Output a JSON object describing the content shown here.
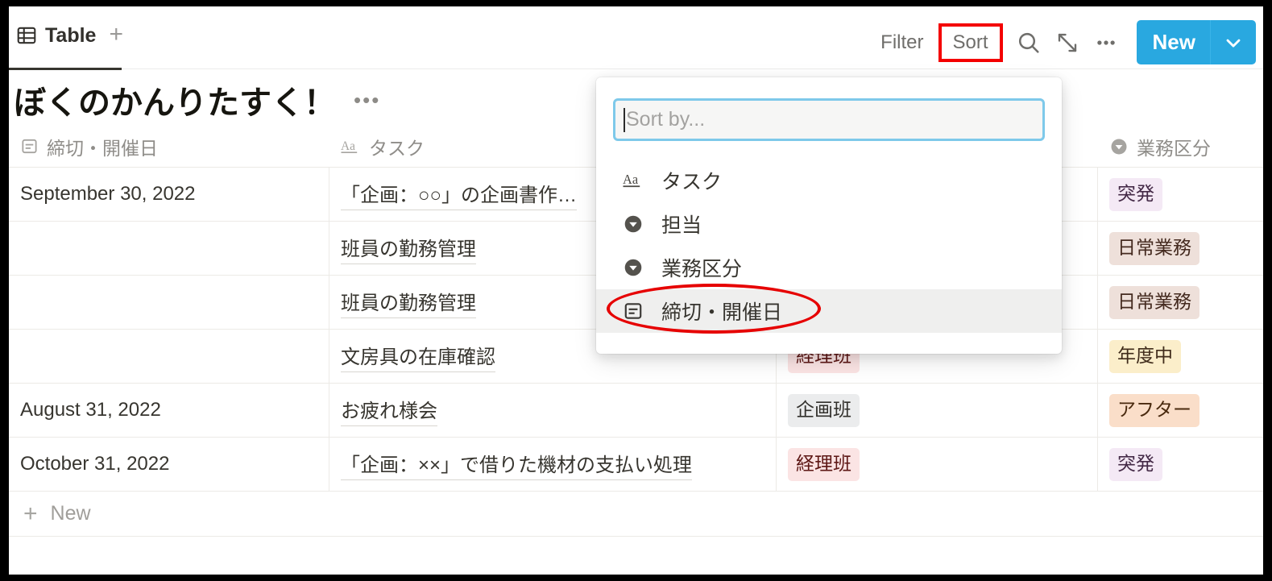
{
  "toolbar": {
    "view_tab_label": "Table",
    "add_view_label": "+",
    "filter_label": "Filter",
    "sort_label": "Sort",
    "search_icon": "search-icon",
    "expand_icon": "expand-icon",
    "more_icon": "more-horizontal-icon",
    "new_label": "New",
    "new_caret_icon": "chevron-down-icon",
    "accent_color": "#29a8e0",
    "highlight_color": "#f40000"
  },
  "page": {
    "title": "ぼくのかんりたすく！",
    "title_menu_icon": "more-horizontal-icon"
  },
  "table": {
    "columns": [
      {
        "label": "締切・開催日",
        "icon": "calendar-date-icon"
      },
      {
        "label": "タスク",
        "icon": "text-aa-icon"
      },
      {
        "label": "",
        "icon": ""
      },
      {
        "label": "業務区分",
        "icon": "select-chevron-icon"
      }
    ],
    "rows": [
      {
        "date": "September 30, 2022",
        "task": "「企画：○○」の企画書作…",
        "team": "",
        "team_style": "",
        "category": "突発",
        "category_style": "tag-purple"
      },
      {
        "date": "",
        "task": "班員の勤務管理",
        "team": "",
        "team_style": "",
        "category": "日常業務",
        "category_style": "tag-brown"
      },
      {
        "date": "",
        "task": "班員の勤務管理",
        "team": "",
        "team_style": "",
        "category": "日常業務",
        "category_style": "tag-brown"
      },
      {
        "date": "",
        "task": "文房具の在庫確認",
        "team": "経理班",
        "team_style": "tag-pink",
        "category": "年度中",
        "category_style": "tag-yellow"
      },
      {
        "date": "August 31, 2022",
        "task": "お疲れ様会",
        "team": "企画班",
        "team_style": "tag-gray",
        "category": "アフター",
        "category_style": "tag-orange"
      },
      {
        "date": "October 31, 2022",
        "task": "「企画：××」で借りた機材の支払い処理",
        "team": "経理班",
        "team_style": "tag-pink",
        "category": "突発",
        "category_style": "tag-purple"
      }
    ],
    "new_row_label": "New",
    "new_row_icon": "plus-icon"
  },
  "sort_popover": {
    "input_value": "",
    "input_placeholder": "Sort by...",
    "options": [
      {
        "label": "タスク",
        "icon": "text-aa-icon",
        "highlighted": false,
        "circled": false
      },
      {
        "label": "担当",
        "icon": "select-chevron-icon",
        "highlighted": false,
        "circled": false
      },
      {
        "label": "業務区分",
        "icon": "select-chevron-icon",
        "highlighted": false,
        "circled": false
      },
      {
        "label": "締切・開催日",
        "icon": "calendar-date-icon",
        "highlighted": true,
        "circled": true
      }
    ]
  }
}
